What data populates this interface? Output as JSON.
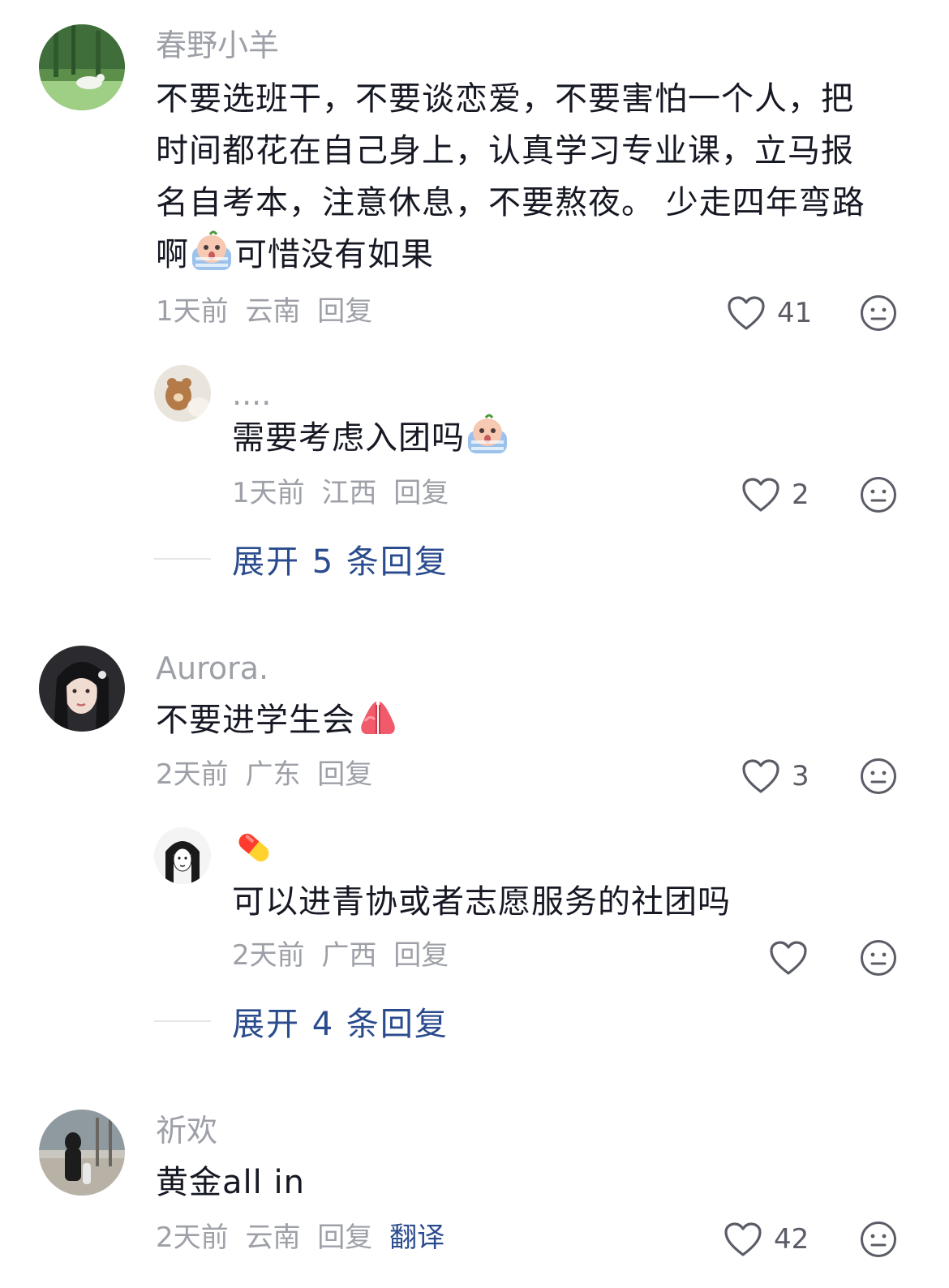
{
  "comments": [
    {
      "username": "春野小羊",
      "text_lines": [
        "不要选班干，不要谈恋爱，不要害怕一个人，把",
        "时间都花在自己身上，认真学习专业课，立马报",
        "名自考本，注意休息，不要熬夜。 少走四年弯路",
        "啊"
      ],
      "text_tail": "可惜没有如果",
      "time": "1天前",
      "location": "云南",
      "reply_label": "回复",
      "likes": "41",
      "replies": [
        {
          "username": "....",
          "text": "需要考虑入团吗",
          "time": "1天前",
          "location": "江西",
          "reply_label": "回复",
          "likes": "2"
        }
      ],
      "expand_label": "展开 5 条回复"
    },
    {
      "username": "Aurora.",
      "text": "不要进学生会",
      "time": "2天前",
      "location": "广东",
      "reply_label": "回复",
      "likes": "3",
      "replies": [
        {
          "username": "",
          "text": "可以进青协或者志愿服务的社团吗",
          "time": "2天前",
          "location": "广西",
          "reply_label": "回复",
          "likes": ""
        }
      ],
      "expand_label": "展开 4 条回复"
    },
    {
      "username": "祈欢",
      "text": "黄金all in",
      "time": "2天前",
      "location": "云南",
      "reply_label": "回复",
      "translate_label": "翻译",
      "likes": "42"
    }
  ],
  "icons": {
    "like": "heart-icon",
    "dislike": "neutral-face-icon",
    "crying_emoji": "crying-face-emoji",
    "pray_emoji": "praying-hands-emoji",
    "pill_emoji": "pill-emoji"
  },
  "colors": {
    "link": "#2a4b8d",
    "meta": "#9ea0a8",
    "text": "#161823"
  }
}
